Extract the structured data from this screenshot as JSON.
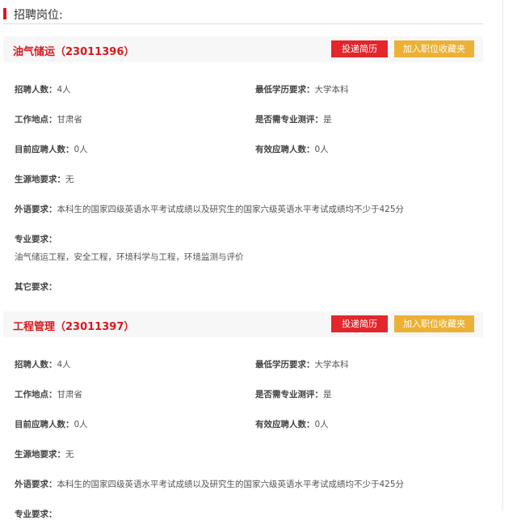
{
  "section_title": "招聘岗位:",
  "apply_label": "投递简历",
  "fav_label": "加入职位收藏夹",
  "jobs": [
    {
      "title": "油气储运（23011396）",
      "fields": {
        "count_l": "招聘人数：",
        "count": "4人",
        "edu_l": "最低学历要求：",
        "edu": "大学本科",
        "loc_l": "工作地点：",
        "loc": "甘肃省",
        "test_l": "是否需专业测评：",
        "test": "是",
        "cur_l": "目前应聘人数：",
        "cur": "0人",
        "valid_l": "有效应聘人数：",
        "valid": "0人",
        "src_l": "生源地要求：",
        "src": "无",
        "lang_l": "外语要求：",
        "lang": "本科生的国家四级英语水平考试成绩以及研究生的国家六级英语水平考试成绩均不少于425分",
        "major_l": "专业要求：",
        "major": "油气储运工程，安全工程，环境科学与工程，环境监测与评价",
        "other_l": "其它要求："
      }
    },
    {
      "title": "工程管理（23011397）",
      "fields": {
        "count_l": "招聘人数：",
        "count": "4人",
        "edu_l": "最低学历要求：",
        "edu": "大学本科",
        "loc_l": "工作地点：",
        "loc": "甘肃省",
        "test_l": "是否需专业测评：",
        "test": "是",
        "cur_l": "目前应聘人数：",
        "cur": "0人",
        "valid_l": "有效应聘人数：",
        "valid": "0人",
        "src_l": "生源地要求：",
        "src": "无",
        "lang_l": "外语要求：",
        "lang": "本科生的国家四级英语水平考试成绩以及研究生的国家六级英语水平考试成绩均不少于425分",
        "major_l": "专业要求："
      }
    }
  ]
}
